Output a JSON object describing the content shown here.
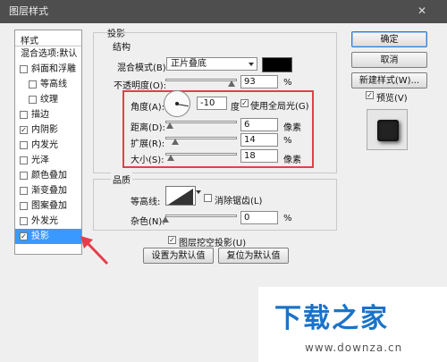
{
  "window": {
    "title": "图层样式",
    "close": "✕"
  },
  "sidebar": {
    "header": "样式",
    "items": [
      {
        "label": "混合选项:默认",
        "checkbox": false,
        "checked": false,
        "selected": false,
        "sub": false
      },
      {
        "label": "斜面和浮雕",
        "checkbox": true,
        "checked": false,
        "selected": false,
        "sub": false
      },
      {
        "label": "等高线",
        "checkbox": true,
        "checked": false,
        "selected": false,
        "sub": true
      },
      {
        "label": "纹理",
        "checkbox": true,
        "checked": false,
        "selected": false,
        "sub": true
      },
      {
        "label": "描边",
        "checkbox": true,
        "checked": false,
        "selected": false,
        "sub": false
      },
      {
        "label": "内阴影",
        "checkbox": true,
        "checked": true,
        "selected": false,
        "sub": false
      },
      {
        "label": "内发光",
        "checkbox": true,
        "checked": false,
        "selected": false,
        "sub": false
      },
      {
        "label": "光泽",
        "checkbox": true,
        "checked": false,
        "selected": false,
        "sub": false
      },
      {
        "label": "颜色叠加",
        "checkbox": true,
        "checked": false,
        "selected": false,
        "sub": false
      },
      {
        "label": "渐变叠加",
        "checkbox": true,
        "checked": false,
        "selected": false,
        "sub": false
      },
      {
        "label": "图案叠加",
        "checkbox": true,
        "checked": false,
        "selected": false,
        "sub": false
      },
      {
        "label": "外发光",
        "checkbox": true,
        "checked": false,
        "selected": false,
        "sub": false
      },
      {
        "label": "投影",
        "checkbox": true,
        "checked": true,
        "selected": true,
        "sub": false
      }
    ]
  },
  "shadow": {
    "section_title": "投影",
    "structure": {
      "title": "结构",
      "blend_mode_label": "混合模式(B):",
      "blend_mode_value": "正片叠底",
      "color": "#000000",
      "opacity_label": "不透明度(O):",
      "opacity_value": "93",
      "opacity_fraction": 0.93,
      "opacity_unit": "%",
      "angle_label": "角度(A):",
      "angle_value": "-10",
      "angle_unit": "度",
      "global_light_label": "使用全局光(G)",
      "global_light_checked": true,
      "distance_label": "距离(D):",
      "distance_value": "6",
      "distance_fraction": 0.06,
      "distance_unit": "像素",
      "spread_label": "扩展(R):",
      "spread_value": "14",
      "spread_fraction": 0.14,
      "spread_unit": "%",
      "size_label": "大小(S):",
      "size_value": "18",
      "size_fraction": 0.07,
      "size_unit": "像素"
    },
    "quality": {
      "title": "品质",
      "contour_label": "等高线:",
      "antialias_label": "消除锯齿(L)",
      "antialias_checked": false,
      "noise_label": "杂色(N):",
      "noise_value": "0",
      "noise_fraction": 0.0,
      "noise_unit": "%"
    },
    "knockout_label": "图层挖空投影(U)",
    "knockout_checked": true,
    "set_default_label": "设置为默认值",
    "reset_default_label": "复位为默认值"
  },
  "buttons": {
    "ok": "确定",
    "cancel": "取消",
    "new_style": "新建样式(W)...",
    "preview_label": "预览(V)",
    "preview_checked": true
  },
  "watermark": {
    "text": "下载之家",
    "url": "www.downza.cn"
  },
  "colors": {
    "accent_selected": "#3a99ff",
    "highlight_box": "#e53e4a",
    "arrow": "#e53e4a"
  }
}
